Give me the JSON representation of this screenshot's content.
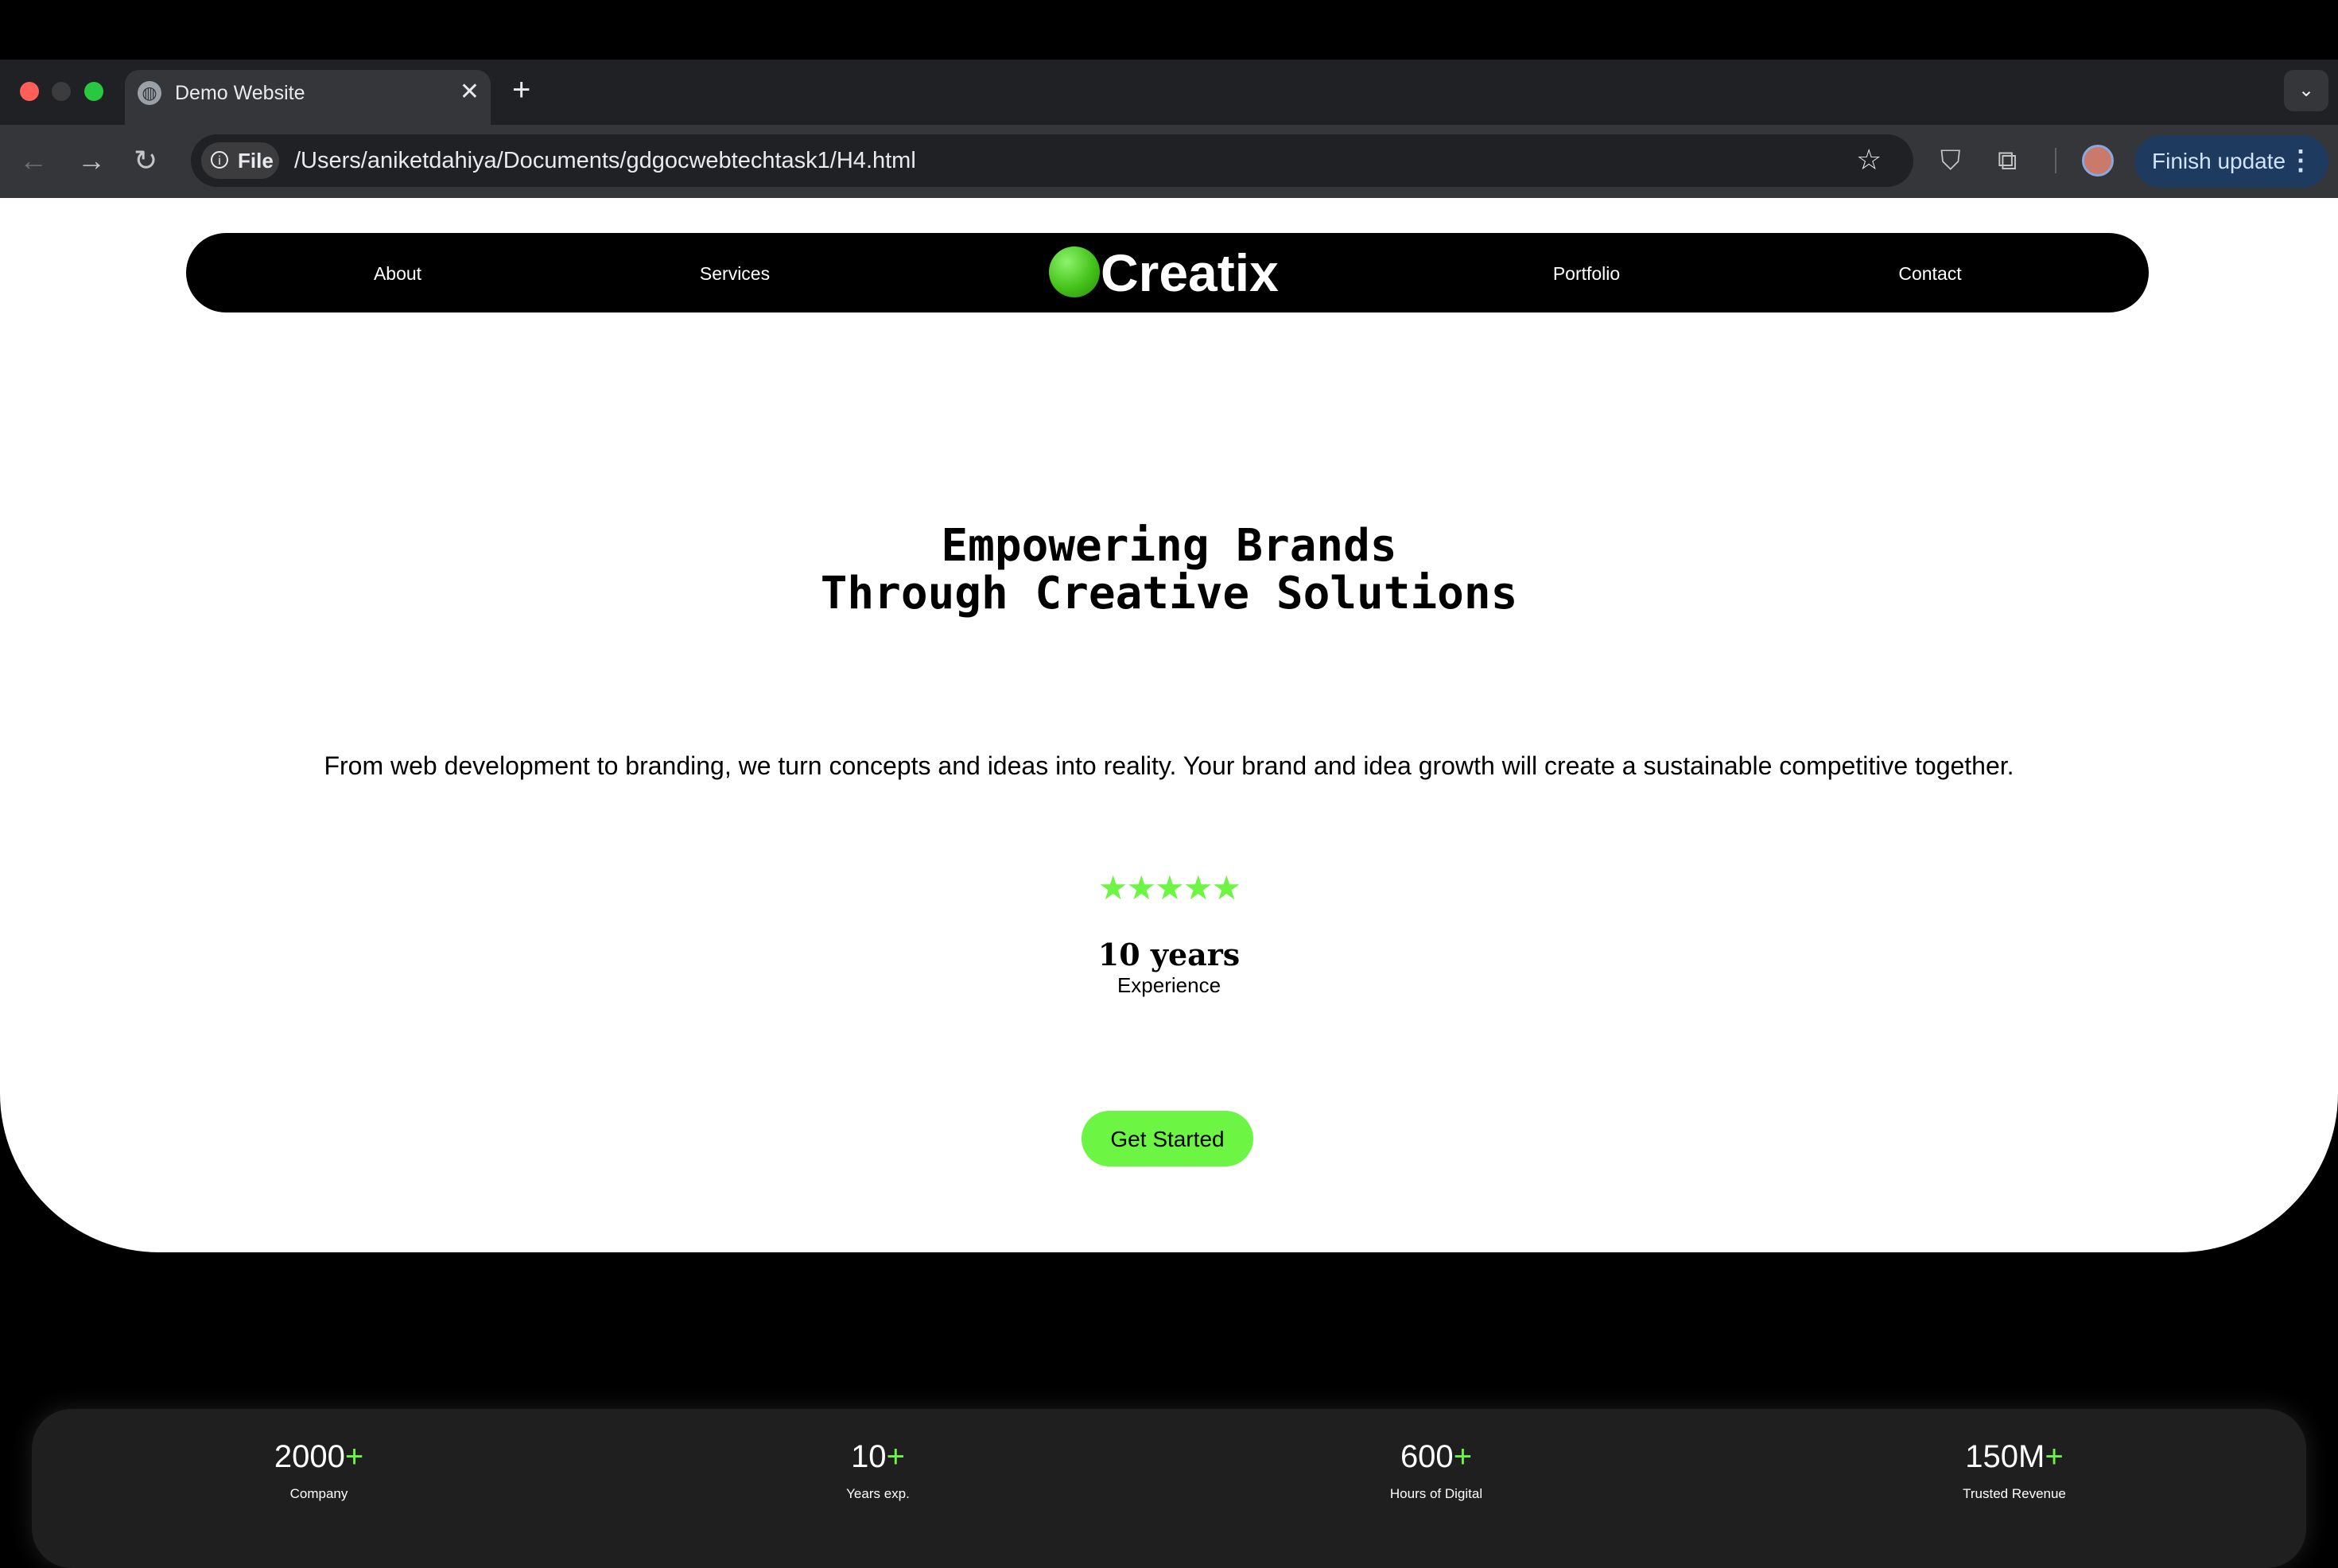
{
  "browser": {
    "tab_title": "Demo Website",
    "tab_close": "✕",
    "new_tab": "+",
    "tab_search": "⌄",
    "back": "←",
    "forward": "→",
    "reload": "↻",
    "chip_label": "File",
    "url": "/Users/aniketdahiya/Documents/gdgocwebtechtask1/H4.html",
    "finish_update": "Finish update",
    "menu_dots": "⋮"
  },
  "nav": {
    "about": "About",
    "services": "Services",
    "logo": "Creatix",
    "portfolio": "Portfolio",
    "contact": "Contact"
  },
  "hero": {
    "headline_line1": "Empowering Brands",
    "headline_line2": "Through Creative Solutions",
    "subtext": "From web development to branding, we turn concepts and ideas into reality. Your brand and idea growth will create a sustainable competitive together.",
    "stars": "★★★★★",
    "rating": 5,
    "experience_years": "10 years",
    "experience_label": "Experience",
    "cta": "Get Started"
  },
  "stats": [
    {
      "value": "2000",
      "plus": "+",
      "label": "Company"
    },
    {
      "value": "10",
      "plus": "+",
      "label": "Years exp."
    },
    {
      "value": "600",
      "plus": "+",
      "label": "Hours of Digital"
    },
    {
      "value": "150M",
      "plus": "+",
      "label": "Trusted Revenue"
    }
  ],
  "colors": {
    "accent": "#6cf542",
    "background": "#000000",
    "hero": "#ffffff",
    "card": "#1f1f1f"
  }
}
